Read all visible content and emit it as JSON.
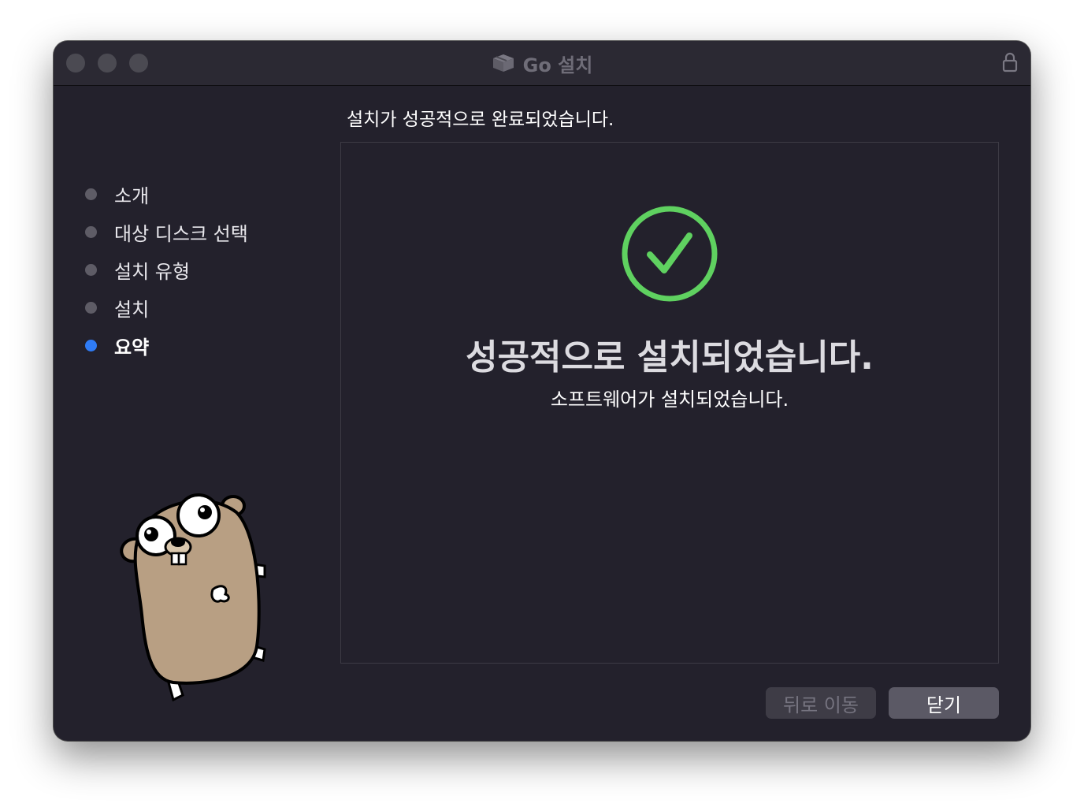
{
  "window": {
    "title": "Go 설치"
  },
  "header": {
    "message": "설치가 성공적으로 완료되었습니다."
  },
  "sidebar": {
    "steps": [
      {
        "label": "소개",
        "active": false
      },
      {
        "label": "대상 디스크 선택",
        "active": false
      },
      {
        "label": "설치 유형",
        "active": false
      },
      {
        "label": "설치",
        "active": false
      },
      {
        "label": "요약",
        "active": true
      }
    ]
  },
  "main": {
    "success_title": "성공적으로 설치되었습니다.",
    "success_subtitle": "소프트웨어가 설치되었습니다."
  },
  "buttons": {
    "back_label": "뒤로 이동",
    "close_label": "닫기"
  },
  "icons": {
    "titlebar": "package-icon",
    "lock": "lock-icon",
    "status": "checkmark-circle-icon",
    "mascot": "go-gopher-mascot"
  },
  "colors": {
    "window_bg": "#23212c",
    "active_step": "#2f7cf6",
    "success_green": "#5fd160"
  }
}
